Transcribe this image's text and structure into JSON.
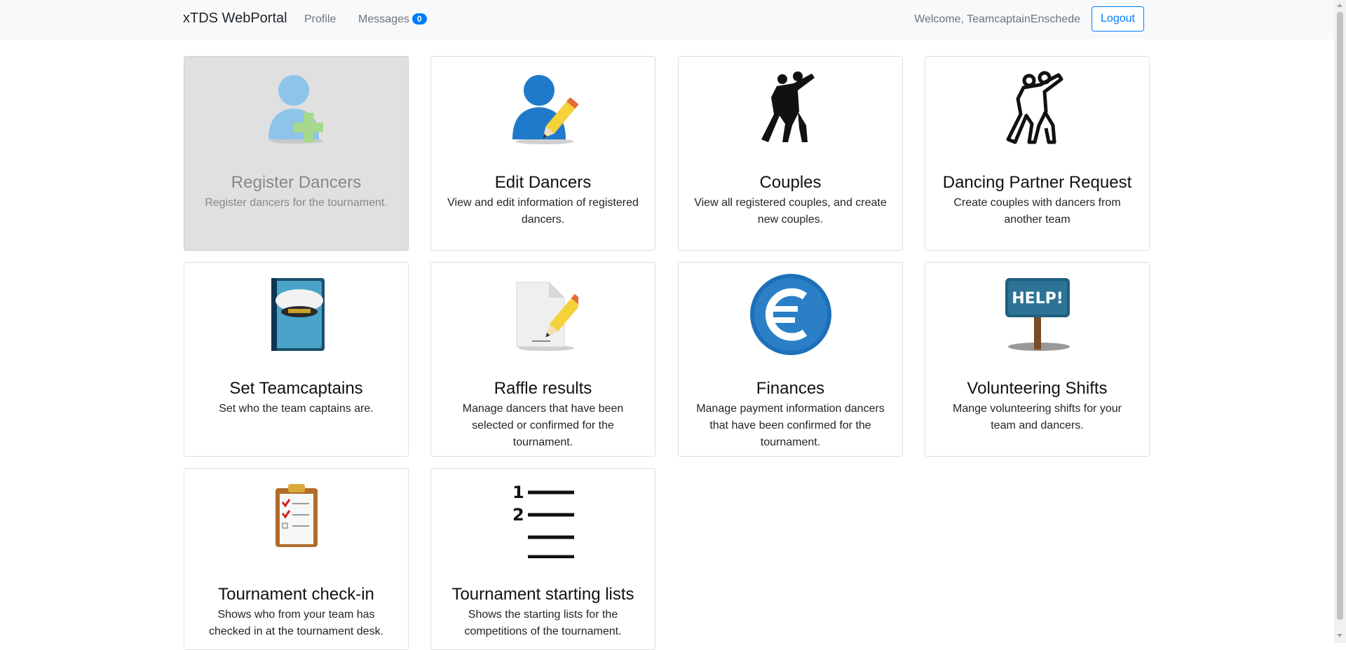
{
  "navbar": {
    "brand": "xTDS WebPortal",
    "profile": "Profile",
    "messages": "Messages",
    "messages_count": "0",
    "welcome": "Welcome, TeamcaptainEnschede",
    "logout": "Logout"
  },
  "cards": [
    {
      "title": "Register Dancers",
      "text": "Register dancers for the tournament.",
      "icon": "user-add-icon",
      "disabled": true
    },
    {
      "title": "Edit Dancers",
      "text": "View and edit information of registered dancers.",
      "icon": "user-edit-icon"
    },
    {
      "title": "Couples",
      "text": "View all registered couples, and create new couples.",
      "icon": "dancing-couple-icon"
    },
    {
      "title": "Dancing Partner Request",
      "text": "Create couples with dancers from another team",
      "icon": "dancing-couple-outline-icon"
    },
    {
      "title": "Set Teamcaptains",
      "text": "Set who the team captains are.",
      "icon": "captain-hat-book-icon"
    },
    {
      "title": "Raffle results",
      "text": "Manage dancers that have been selected or confirmed for the tournament.",
      "icon": "document-edit-icon"
    },
    {
      "title": "Finances",
      "text": "Manage payment information dancers that have been confirmed for the tournament.",
      "icon": "euro-icon"
    },
    {
      "title": "Volunteering Shifts",
      "text": "Mange volunteering shifts for your team and dancers.",
      "icon": "help-sign-icon"
    },
    {
      "title": "Tournament check-in",
      "text": "Shows who from your team has checked in at the tournament desk.",
      "icon": "clipboard-checklist-icon"
    },
    {
      "title": "Tournament starting lists",
      "text": "Shows the starting lists for the competitions of the tournament.",
      "icon": "numbered-list-icon"
    }
  ],
  "colors": {
    "accent": "#007bff",
    "navbar_bg": "#f8f9fa",
    "disabled_card_bg": "#e0e0e0"
  }
}
